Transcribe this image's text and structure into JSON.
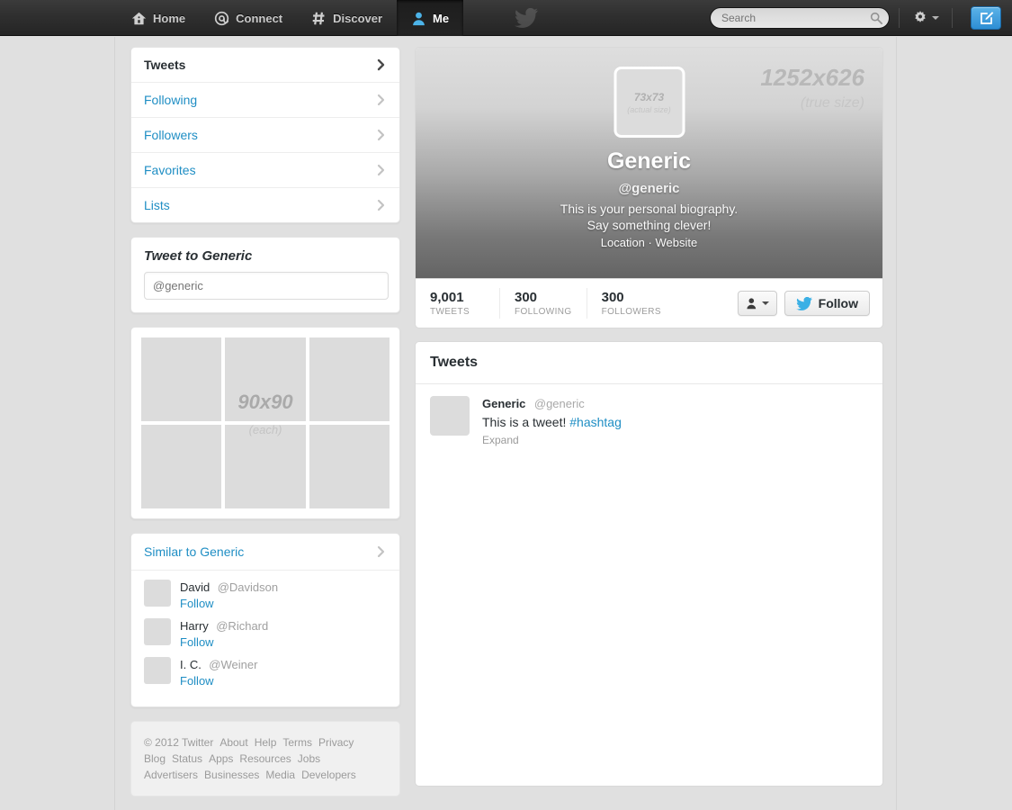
{
  "nav": {
    "items": [
      {
        "label": "Home",
        "icon": "home-icon",
        "active": false
      },
      {
        "label": "Connect",
        "icon": "at-icon",
        "active": false
      },
      {
        "label": "Discover",
        "icon": "hashtag-icon",
        "active": false
      },
      {
        "label": "Me",
        "icon": "person-icon",
        "active": true
      }
    ],
    "logo_icon": "twitter-bird-icon",
    "search": {
      "placeholder": "Search",
      "value": "",
      "icon": "search-icon"
    },
    "settings_icon": "gear-icon",
    "compose_icon": "compose-tweet-icon"
  },
  "sidebar": {
    "nav": [
      {
        "label": "Tweets",
        "selected": true
      },
      {
        "label": "Following",
        "selected": false
      },
      {
        "label": "Followers",
        "selected": false
      },
      {
        "label": "Favorites",
        "selected": false
      },
      {
        "label": "Lists",
        "selected": false
      }
    ],
    "compose": {
      "title": "Tweet to Generic",
      "placeholder": "@generic",
      "value": ""
    },
    "photo_grid": {
      "size_label": "90x90",
      "each_label": "(each)",
      "cells": 6
    },
    "similar": {
      "title": "Similar to Generic",
      "users": [
        {
          "name": "David",
          "handle": "@Davidson",
          "follow_label": "Follow"
        },
        {
          "name": "Harry",
          "handle": "@Richard",
          "follow_label": "Follow"
        },
        {
          "name": "I. C.",
          "handle": "@Weiner",
          "follow_label": "Follow"
        }
      ]
    },
    "footer_links": [
      "© 2012 Twitter",
      "About",
      "Help",
      "Terms",
      "Privacy",
      "Blog",
      "Status",
      "Apps",
      "Resources",
      "Jobs",
      "Advertisers",
      "Businesses",
      "Media",
      "Developers"
    ]
  },
  "profile": {
    "banner_size_label": "1252x626",
    "banner_size_note": "(true size)",
    "avatar_size_label": "73x73",
    "avatar_size_note": "(actual size)",
    "name": "Generic",
    "handle": "@generic",
    "bio_line1": "This is your personal biography.",
    "bio_line2": "Say something clever!",
    "location": "Location",
    "separator": "·",
    "website": "Website",
    "stats": [
      {
        "number": "9,001",
        "label": "TWEETS"
      },
      {
        "number": "300",
        "label": "FOLLOWING"
      },
      {
        "number": "300",
        "label": "FOLLOWERS"
      }
    ],
    "user_actions_icon": "person-dropdown-icon",
    "follow_button": {
      "label": "Follow",
      "icon": "twitter-bird-icon"
    }
  },
  "timeline": {
    "title": "Tweets",
    "tweets": [
      {
        "name": "Generic",
        "handle": "@generic",
        "text": "This is a tweet! ",
        "hashtag": "#hashtag",
        "expand_label": "Expand"
      }
    ]
  },
  "colors": {
    "accent_blue": "#1f8ec4",
    "nav_dark": "#2f2f2f",
    "page_bg": "#e0e0e0"
  }
}
